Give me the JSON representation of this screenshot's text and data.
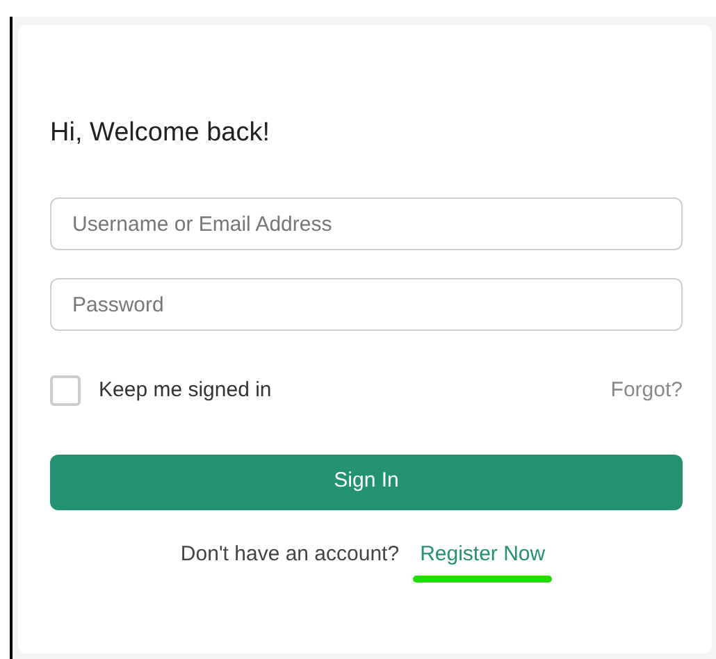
{
  "heading": "Hi, Welcome back!",
  "fields": [
    {
      "placeholder": "Username or Email Address"
    },
    {
      "placeholder": "Password"
    }
  ],
  "remember": {
    "label": "Keep me signed in",
    "checked": false
  },
  "forgot": "Forgot?",
  "submit": "Sign In",
  "register": {
    "prompt": "Don't have an account?",
    "link": "Register Now",
    "highlighted": true
  }
}
